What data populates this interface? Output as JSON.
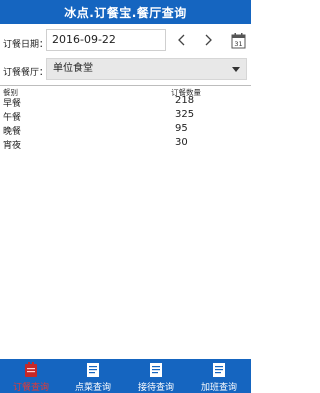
{
  "header": {
    "title": "冰点.订餐宝.餐厅查询"
  },
  "filters": {
    "date_label": "订餐日期：",
    "date_value": "2016-09-22",
    "restaurant_label": "订餐餐厅：",
    "restaurant_value": "单位食堂"
  },
  "table": {
    "columns": [
      "餐别",
      "订餐数量"
    ],
    "rows": [
      {
        "meal": "早餐",
        "count": "218"
      },
      {
        "meal": "午餐",
        "count": "325"
      },
      {
        "meal": "晚餐",
        "count": "95"
      },
      {
        "meal": "宵夜",
        "count": "30"
      }
    ]
  },
  "tabbar": {
    "tabs": [
      {
        "label": "订餐查询",
        "icon": "restaurant-icon",
        "active": true
      },
      {
        "label": "点菜查询",
        "icon": "menu-doc-icon",
        "active": false
      },
      {
        "label": "接待查询",
        "icon": "reception-doc-icon",
        "active": false
      },
      {
        "label": "加班查询",
        "icon": "overtime-doc-icon",
        "active": false
      }
    ]
  },
  "colors": {
    "primary": "#1565c0",
    "active_tab": "#e53935"
  }
}
